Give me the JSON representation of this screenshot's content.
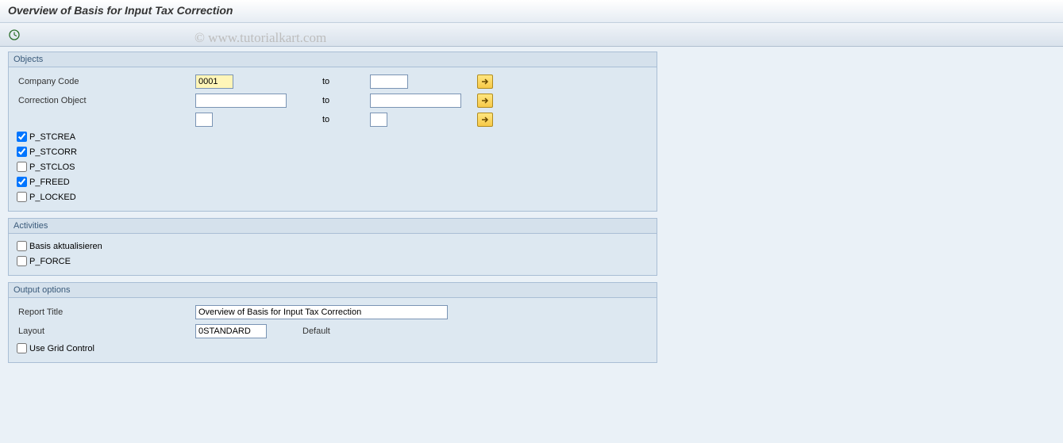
{
  "header": {
    "title": "Overview of Basis for Input Tax Correction"
  },
  "watermark": "© www.tutorialkart.com",
  "groups": {
    "objects": {
      "title": "Objects",
      "rows": {
        "company_code": {
          "label": "Company Code",
          "from": "0001",
          "to_label": "to",
          "to": ""
        },
        "correction_object": {
          "label": "Correction Object",
          "from": "",
          "to_label": "to",
          "to": ""
        },
        "blank": {
          "label": "",
          "from": "",
          "to_label": "to",
          "to": ""
        }
      },
      "checks": {
        "p_stcrea": {
          "label": "P_STCREA",
          "checked": true
        },
        "p_stcorr": {
          "label": "P_STCORR",
          "checked": true
        },
        "p_stclos": {
          "label": "P_STCLOS",
          "checked": false
        },
        "p_freed": {
          "label": "P_FREED",
          "checked": true
        },
        "p_locked": {
          "label": "P_LOCKED",
          "checked": false
        }
      }
    },
    "activities": {
      "title": "Activities",
      "checks": {
        "basis": {
          "label": "Basis aktualisieren",
          "checked": false
        },
        "p_force": {
          "label": "P_FORCE",
          "checked": false
        }
      }
    },
    "output": {
      "title": "Output options",
      "report_title": {
        "label": "Report Title",
        "value": "Overview of Basis for Input Tax Correction"
      },
      "layout": {
        "label": "Layout",
        "value": "0STANDARD",
        "default_label": "Default"
      },
      "use_grid": {
        "label": "Use Grid Control",
        "checked": false
      }
    }
  }
}
